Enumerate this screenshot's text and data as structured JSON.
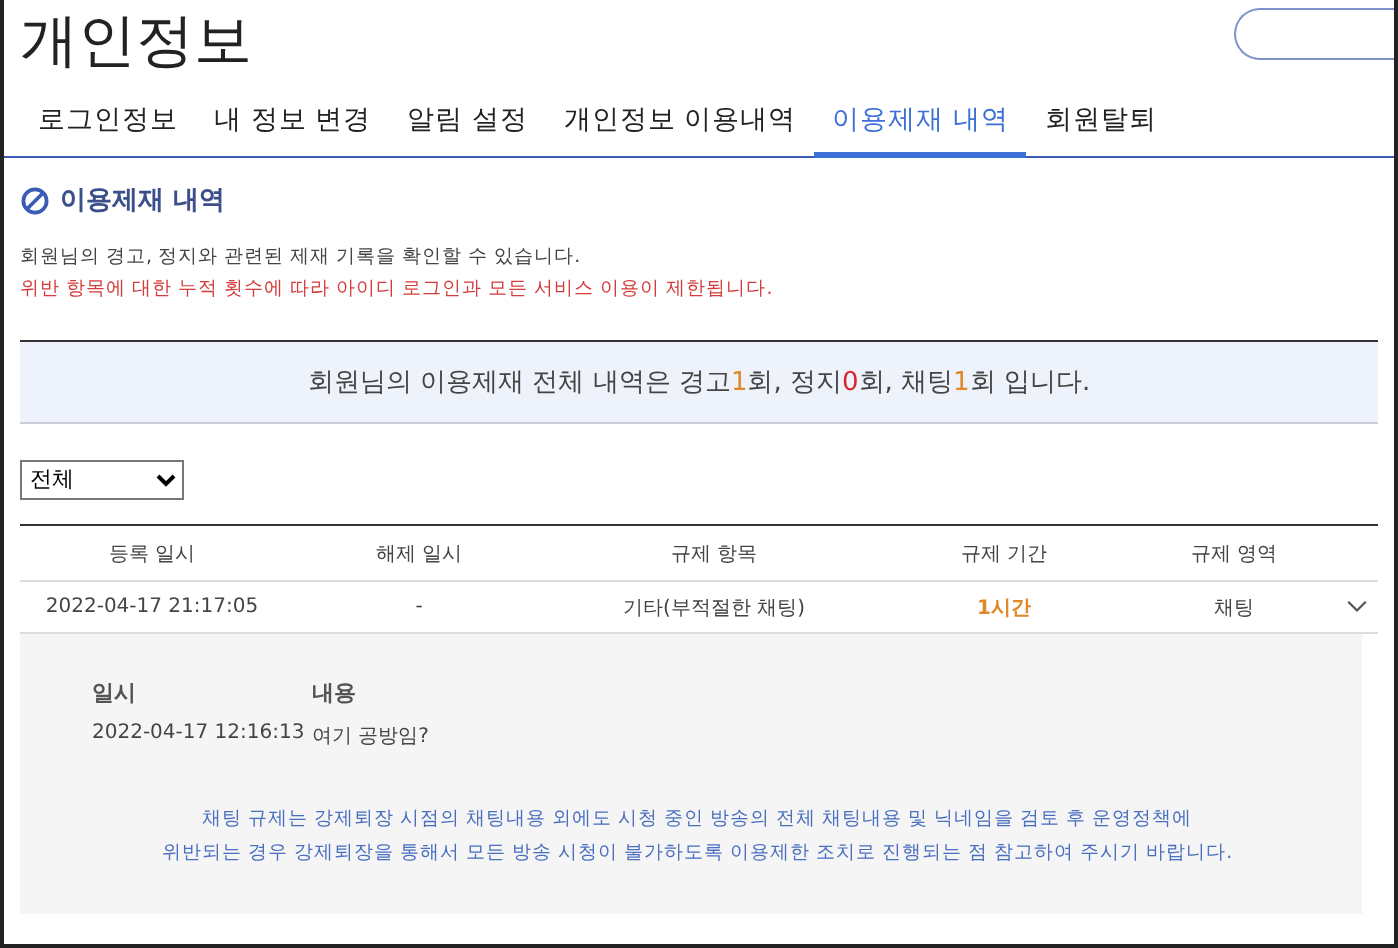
{
  "page_title": "개인정보",
  "tabs": [
    {
      "label": "로그인정보",
      "selected": false
    },
    {
      "label": "내 정보 변경",
      "selected": false
    },
    {
      "label": "알림 설정",
      "selected": false
    },
    {
      "label": "개인정보 이용내역",
      "selected": false
    },
    {
      "label": "이용제재 내역",
      "selected": true
    },
    {
      "label": "회원탈퇴",
      "selected": false
    }
  ],
  "section_title": "이용제재 내역",
  "notice": "회원님의 경고, 정지와 관련된 제재 기록을 확인할 수 있습니다.",
  "warning": "위반 항목에 대한 누적 횟수에 따라 아이디 로그인과 모든 서비스 이용이 제한됩니다.",
  "summary": [
    {
      "text": "회원님의 이용제재 전체 내역은 경고"
    },
    {
      "text": "1",
      "color": "#e0892a"
    },
    {
      "text": "회, 정지"
    },
    {
      "text": "0",
      "color": "#d9262b"
    },
    {
      "text": "회, 채팅"
    },
    {
      "text": "1",
      "color": "#e0892a"
    },
    {
      "text": "회 입니다."
    }
  ],
  "filter": {
    "value": "전체"
  },
  "table": {
    "columns": [
      "등록 일시",
      "해제 일시",
      "규제 항목",
      "규제 기간",
      "규제 영역"
    ],
    "rows": [
      {
        "cells": [
          "2022-04-17 21:17:05",
          "-",
          "기타(부적절한 채팅)",
          "1시간",
          "채팅"
        ],
        "expanded": true,
        "detail": {
          "headers": [
            "일시",
            "내용"
          ],
          "values": [
            "2022-04-17 12:16:13",
            "여기 공방임?"
          ],
          "note": "채팅 규제는 강제퇴장 시점의 채팅내용 외에도 시청 중인 방송의 전체 채팅내용 및 닉네임을 검토 후 운영정책에\n위반되는 경우 강제퇴장을 통해서 모든 방송 시청이 불가하도록 이용제한 조치로 진행되는 점 참고하여 주시기 바랍니다."
        }
      }
    ]
  }
}
